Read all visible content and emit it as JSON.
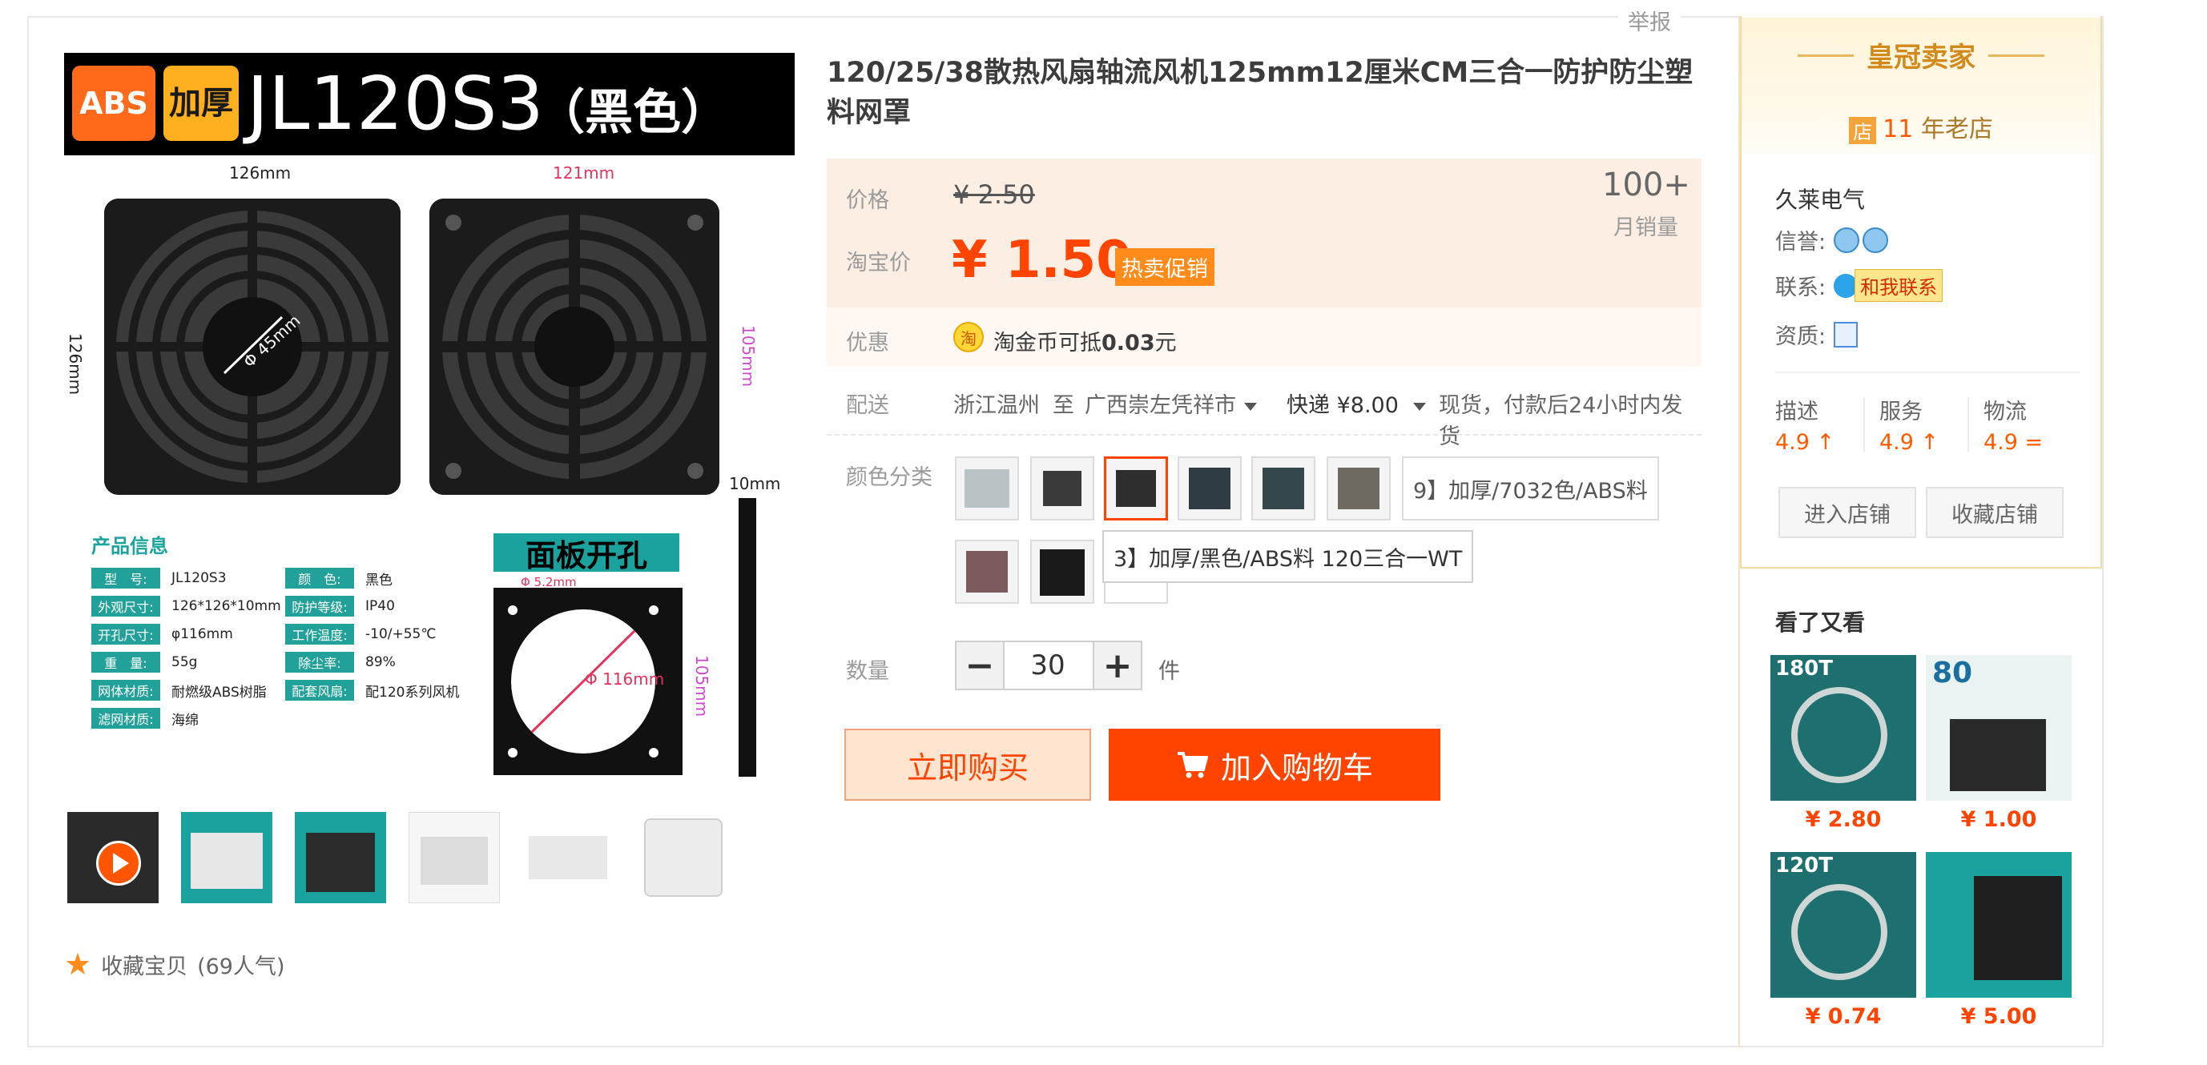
{
  "header": {
    "report": "举报"
  },
  "main_image": {
    "badge_abs": "ABS",
    "badge_thick": "加厚",
    "model": "JL120S3",
    "color": "（黑色）",
    "dims": {
      "d126_top": "126mm",
      "d121_top": "121mm",
      "d126_side": "126mm",
      "d105_side": "105mm",
      "d45": "Φ 45mm",
      "d10": "10mm",
      "d5_2": "Φ 5.2mm",
      "d116": "Φ 116mm",
      "d105_panel": "105mm"
    },
    "spec_title": "产品信息",
    "specs": [
      {
        "k": "型　号:",
        "v": "JL120S3"
      },
      {
        "k": "外观尺寸:",
        "v": "126*126*10mm"
      },
      {
        "k": "开孔尺寸:",
        "v": "φ116mm"
      },
      {
        "k": "重　量:",
        "v": "55g"
      },
      {
        "k": "网体材质:",
        "v": "耐燃级ABS树脂"
      },
      {
        "k": "滤网材质:",
        "v": "海绵"
      }
    ],
    "specs_right": [
      {
        "k": "颜　色:",
        "v": "黑色"
      },
      {
        "k": "防护等级:",
        "v": "IP40"
      },
      {
        "k": "工作温度:",
        "v": "-10/+55℃"
      },
      {
        "k": "除尘率:",
        "v": "89%"
      },
      {
        "k": "配套风扇:",
        "v": "配120系列风机"
      }
    ],
    "panel_title": "面板开孔"
  },
  "favorite": {
    "label": "收藏宝贝",
    "count": "(69人气)"
  },
  "product": {
    "title": "120/25/38散热风扇轴流风机125mm12厘米CM三合一防护防尘塑料网罩",
    "price_label": "价格",
    "orig_price": "¥ 2.50",
    "tb_price_label": "淘宝价",
    "tb_price": "¥ 1.50",
    "promo": "热卖促销",
    "sales_num": "100+",
    "sales_label": "月销量",
    "coupon_label": "优惠",
    "coupon_icon": "淘",
    "coupon_text_a": "淘金币可抵",
    "coupon_amount": "0.03",
    "coupon_text_b": "元",
    "ship_label": "配送",
    "ship_from": "浙江温州",
    "ship_to_word": "至",
    "ship_to": "广西崇左凭祥市",
    "ship_fee": "快递 ¥8.00",
    "ship_note": "现货，付款后24小时内发货",
    "color_label": "颜色分类",
    "sku_text_option": "9】加厚/7032色/ABS料",
    "tooltip": "3】加厚/黑色/ABS料 120三合一WT",
    "qty_label": "数量",
    "qty_minus": "−",
    "qty_plus": "+",
    "qty_value": "30",
    "qty_unit": "件",
    "buy_now": "立即购买",
    "add_cart": "加入购物车"
  },
  "seller": {
    "crown": "皇冠卖家",
    "years_icon": "店",
    "years_num": "11",
    "years_text": " 年老店",
    "name": "久莱电气",
    "credit_label": "信誉:",
    "contact_label": "联系:",
    "contact_btn": "和我联系",
    "qual_label": "资质:",
    "ratings": [
      {
        "label": "描述",
        "value": "4.9 ↑"
      },
      {
        "label": "服务",
        "value": "4.9 ↑"
      },
      {
        "label": "物流",
        "value": "4.9 ="
      }
    ],
    "enter_shop": "进入店铺",
    "fav_shop": "收藏店铺"
  },
  "recommend": {
    "title": "看了又看",
    "items": [
      {
        "tag": "180T",
        "price": "¥ 2.80"
      },
      {
        "tag": "80",
        "price": "¥ 1.00"
      },
      {
        "tag": "120T",
        "price": "¥ 0.74"
      },
      {
        "tag": "",
        "price": "¥ 5.00"
      }
    ]
  },
  "colors": {
    "accent": "#ff4400",
    "promo": "#ff8c1a",
    "teal": "#1aa39e",
    "gold": "#d48a1a"
  }
}
